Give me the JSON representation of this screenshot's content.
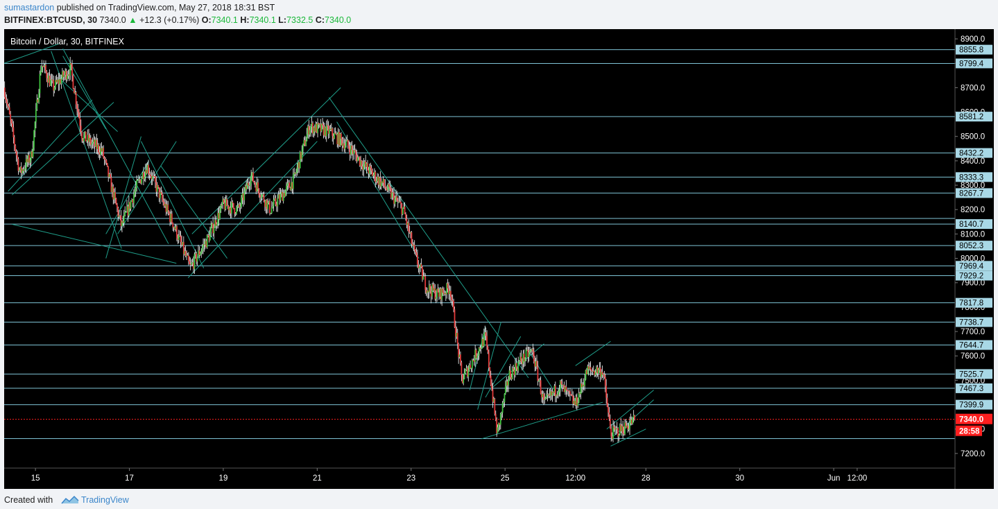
{
  "header": {
    "author": "sumastardon",
    "published_text": "published on TradingView.com, May 27, 2018 18:31 BST",
    "symbol": "BITFINEX:BTCUSD, 30",
    "last": "7340.0",
    "change": "+12.3 (+0.17%)",
    "o_label": "O:",
    "o_value": "7340.1",
    "h_label": "H:",
    "h_value": "7340.1",
    "l_label": "L:",
    "l_value": "7332.5",
    "c_label": "C:",
    "c_value": "7340.0"
  },
  "footer": {
    "created_with": "Created with",
    "brand": "TradingView"
  },
  "colors": {
    "background": "#000000",
    "up": "#3ec23e",
    "down": "#e23a3a",
    "wick": "#ffffff",
    "hline": "#7fc4d6",
    "trendline": "#1f9e8a",
    "label_bg": "#a8d8e6",
    "current_price": "#ff1f1f",
    "axis_text": "#ffffff",
    "link": "#3b86ca"
  },
  "chart_data": {
    "type": "candlestick",
    "title": "Bitcoin / Dollar, 30, BITFINEX",
    "ylim": [
      7140,
      8940
    ],
    "y_ticks": [
      "7200.0",
      "7300.0",
      "7400.0",
      "7500.0",
      "7600.0",
      "7700.0",
      "7800.0",
      "7900.0",
      "8000.0",
      "8100.0",
      "8200.0",
      "8300.0",
      "8400.0",
      "8500.0",
      "8600.0",
      "8700.0",
      "8800.0",
      "8900.0"
    ],
    "x_range": [
      "2018-05-14T08:00",
      "2018-06-03T14:00"
    ],
    "x_ticks": [
      {
        "label": "15",
        "t": "2018-05-15T00:00"
      },
      {
        "label": "17",
        "t": "2018-05-17T00:00"
      },
      {
        "label": "19",
        "t": "2018-05-19T00:00"
      },
      {
        "label": "21",
        "t": "2018-05-21T00:00"
      },
      {
        "label": "23",
        "t": "2018-05-23T00:00"
      },
      {
        "label": "25",
        "t": "2018-05-25T00:00"
      },
      {
        "label": "12:00",
        "t": "2018-05-26T12:00"
      },
      {
        "label": "28",
        "t": "2018-05-28T00:00"
      },
      {
        "label": "30",
        "t": "2018-05-30T00:00"
      },
      {
        "label": "Jun",
        "t": "2018-06-01T00:00"
      },
      {
        "label": "12:00",
        "t": "2018-06-01T12:00"
      }
    ],
    "horizontal_levels": [
      {
        "value": 8855.8,
        "label": "8855.8"
      },
      {
        "value": 8799.4,
        "label": "8799.4"
      },
      {
        "value": 8581.2,
        "label": "8581.2"
      },
      {
        "value": 8432.2,
        "label": "8432.2"
      },
      {
        "value": 8333.3,
        "label": "8333.3"
      },
      {
        "value": 8267.7,
        "label": "8267.7"
      },
      {
        "value": 8163.7,
        "label": ""
      },
      {
        "value": 8140.7,
        "label": "8140.7"
      },
      {
        "value": 8052.3,
        "label": "8052.3"
      },
      {
        "value": 7969.4,
        "label": "7969.4"
      },
      {
        "value": 7929.2,
        "label": "7929.2"
      },
      {
        "value": 7817.8,
        "label": "7817.8"
      },
      {
        "value": 7738.7,
        "label": "7738.7"
      },
      {
        "value": 7644.7,
        "label": "7644.7"
      },
      {
        "value": 7525.7,
        "label": "7525.7"
      },
      {
        "value": 7467.3,
        "label": "7467.3"
      },
      {
        "value": 7399.9,
        "label": "7399.9"
      },
      {
        "value": 7260.7,
        "label": ""
      }
    ],
    "current_price": {
      "value": 7340.0,
      "label": "7340.0",
      "countdown": "28:58"
    },
    "price_path": [
      {
        "t": "2018-05-14T08:00",
        "p": 8700
      },
      {
        "t": "2018-05-14T16:00",
        "p": 8350
      },
      {
        "t": "2018-05-14T22:00",
        "p": 8420
      },
      {
        "t": "2018-05-15T03:00",
        "p": 8800
      },
      {
        "t": "2018-05-15T09:00",
        "p": 8700
      },
      {
        "t": "2018-05-15T18:00",
        "p": 8780
      },
      {
        "t": "2018-05-16T00:00",
        "p": 8500
      },
      {
        "t": "2018-05-16T10:00",
        "p": 8440
      },
      {
        "t": "2018-05-16T20:00",
        "p": 8130
      },
      {
        "t": "2018-05-17T04:00",
        "p": 8300
      },
      {
        "t": "2018-05-17T09:00",
        "p": 8380
      },
      {
        "t": "2018-05-17T16:00",
        "p": 8250
      },
      {
        "t": "2018-05-17T22:00",
        "p": 8150
      },
      {
        "t": "2018-05-18T07:00",
        "p": 7960
      },
      {
        "t": "2018-05-18T16:00",
        "p": 8080
      },
      {
        "t": "2018-05-19T00:00",
        "p": 8220
      },
      {
        "t": "2018-05-19T08:00",
        "p": 8200
      },
      {
        "t": "2018-05-19T14:00",
        "p": 8340
      },
      {
        "t": "2018-05-20T00:00",
        "p": 8200
      },
      {
        "t": "2018-05-20T12:00",
        "p": 8320
      },
      {
        "t": "2018-05-20T20:00",
        "p": 8540
      },
      {
        "t": "2018-05-21T06:00",
        "p": 8520
      },
      {
        "t": "2018-05-21T16:00",
        "p": 8460
      },
      {
        "t": "2018-05-22T00:00",
        "p": 8380
      },
      {
        "t": "2018-05-22T10:00",
        "p": 8300
      },
      {
        "t": "2018-05-22T20:00",
        "p": 8200
      },
      {
        "t": "2018-05-23T02:00",
        "p": 8010
      },
      {
        "t": "2018-05-23T08:00",
        "p": 7880
      },
      {
        "t": "2018-05-23T14:00",
        "p": 7850
      },
      {
        "t": "2018-05-23T20:00",
        "p": 7880
      },
      {
        "t": "2018-05-24T02:00",
        "p": 7500
      },
      {
        "t": "2018-05-24T10:00",
        "p": 7620
      },
      {
        "t": "2018-05-24T14:00",
        "p": 7680
      },
      {
        "t": "2018-05-24T20:00",
        "p": 7280
      },
      {
        "t": "2018-05-25T02:00",
        "p": 7520
      },
      {
        "t": "2018-05-25T08:00",
        "p": 7580
      },
      {
        "t": "2018-05-25T14:00",
        "p": 7620
      },
      {
        "t": "2018-05-25T20:00",
        "p": 7400
      },
      {
        "t": "2018-05-26T04:00",
        "p": 7480
      },
      {
        "t": "2018-05-26T12:00",
        "p": 7400
      },
      {
        "t": "2018-05-26T18:00",
        "p": 7540
      },
      {
        "t": "2018-05-27T02:00",
        "p": 7540
      },
      {
        "t": "2018-05-27T06:00",
        "p": 7280
      },
      {
        "t": "2018-05-27T12:00",
        "p": 7300
      },
      {
        "t": "2018-05-27T18:30",
        "p": 7340
      }
    ],
    "trendlines": [
      {
        "t1": "2018-05-14T08:00",
        "p1": 8800,
        "t2": "2018-05-15T12:00",
        "p2": 8880
      },
      {
        "t1": "2018-05-14T10:00",
        "p1": 8275,
        "t2": "2018-05-16T05:00",
        "p2": 8650
      },
      {
        "t1": "2018-05-14T12:00",
        "p1": 8260,
        "t2": "2018-05-16T16:00",
        "p2": 8640
      },
      {
        "t1": "2018-05-14T12:00",
        "p1": 8140,
        "t2": "2018-05-18T00:00",
        "p2": 7980
      },
      {
        "t1": "2018-05-15T08:00",
        "p1": 8850,
        "t2": "2018-05-16T20:00",
        "p2": 8040
      },
      {
        "t1": "2018-05-15T14:00",
        "p1": 8860,
        "t2": "2018-05-17T20:00",
        "p2": 8060
      },
      {
        "t1": "2018-05-15T14:00",
        "p1": 8830,
        "t2": "2018-05-16T12:00",
        "p2": 8530
      },
      {
        "t1": "2018-05-15T12:00",
        "p1": 8740,
        "t2": "2018-05-16T18:00",
        "p2": 8520
      },
      {
        "t1": "2018-05-16T12:00",
        "p1": 8000,
        "t2": "2018-05-17T06:00",
        "p2": 8500
      },
      {
        "t1": "2018-05-16T18:00",
        "p1": 8100,
        "t2": "2018-05-18T00:00",
        "p2": 8480
      },
      {
        "t1": "2018-05-16T12:00",
        "p1": 8100,
        "t2": "2018-05-17T10:00",
        "p2": 8400
      },
      {
        "t1": "2018-05-17T06:00",
        "p1": 8480,
        "t2": "2018-05-18T14:00",
        "p2": 7960
      },
      {
        "t1": "2018-05-17T16:00",
        "p1": 8380,
        "t2": "2018-05-19T02:00",
        "p2": 8000
      },
      {
        "t1": "2018-05-18T06:00",
        "p1": 7920,
        "t2": "2018-05-21T00:00",
        "p2": 8480
      },
      {
        "t1": "2018-05-18T08:00",
        "p1": 8100,
        "t2": "2018-05-21T12:00",
        "p2": 8700
      },
      {
        "t1": "2018-05-21T06:00",
        "p1": 8660,
        "t2": "2018-05-25T12:00",
        "p2": 7510
      },
      {
        "t1": "2018-05-21T10:00",
        "p1": 8560,
        "t2": "2018-05-23T04:00",
        "p2": 8000
      },
      {
        "t1": "2018-05-24T06:00",
        "p1": 7460,
        "t2": "2018-05-24T14:00",
        "p2": 7720
      },
      {
        "t1": "2018-05-24T10:00",
        "p1": 7380,
        "t2": "2018-05-24T22:00",
        "p2": 7740
      },
      {
        "t1": "2018-05-24T14:00",
        "p1": 7430,
        "t2": "2018-05-25T08:00",
        "p2": 7680
      },
      {
        "t1": "2018-05-24T16:00",
        "p1": 7460,
        "t2": "2018-05-25T20:00",
        "p2": 7650
      },
      {
        "t1": "2018-05-24T12:00",
        "p1": 7260,
        "t2": "2018-05-27T02:00",
        "p2": 7410
      },
      {
        "t1": "2018-05-25T12:00",
        "p1": 7620,
        "t2": "2018-05-26T00:00",
        "p2": 7470
      },
      {
        "t1": "2018-05-26T12:00",
        "p1": 7560,
        "t2": "2018-05-27T06:00",
        "p2": 7660
      },
      {
        "t1": "2018-05-27T04:00",
        "p1": 7300,
        "t2": "2018-05-28T04:00",
        "p2": 7460
      },
      {
        "t1": "2018-05-27T06:00",
        "p1": 7230,
        "t2": "2018-05-28T00:00",
        "p2": 7300
      },
      {
        "t1": "2018-05-27T06:00",
        "p1": 7260,
        "t2": "2018-05-28T04:00",
        "p2": 7420
      }
    ]
  }
}
